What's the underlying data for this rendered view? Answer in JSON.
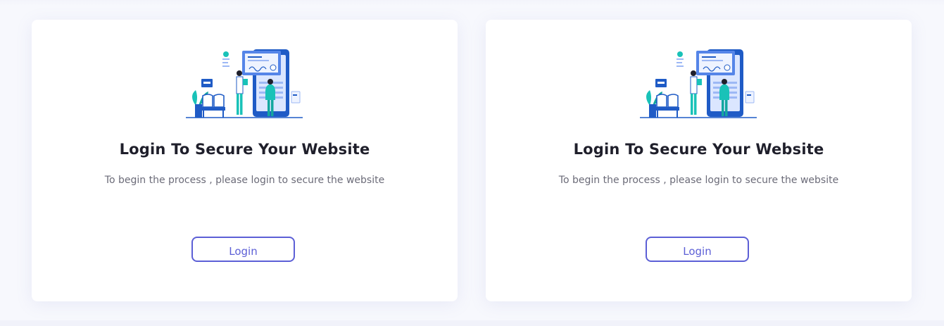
{
  "cards": [
    {
      "illustration_icon": "secure-login-illustration-icon",
      "title": "Login To Secure Your Website",
      "subtitle": "To begin the process , please login to secure the website",
      "button_label": "Login"
    },
    {
      "illustration_icon": "secure-login-illustration-icon",
      "title": "Login To Secure Your Website",
      "subtitle": "To begin the process , please login to secure the website",
      "button_label": "Login"
    }
  ],
  "colors": {
    "accent": "#5c5fd6",
    "background": "#f7f8fd",
    "card": "#ffffff",
    "title": "#1f1f2b",
    "subtitle": "#6b6b78",
    "illustration_blue": "#1f5bc6",
    "illustration_teal": "#19c2b8"
  }
}
